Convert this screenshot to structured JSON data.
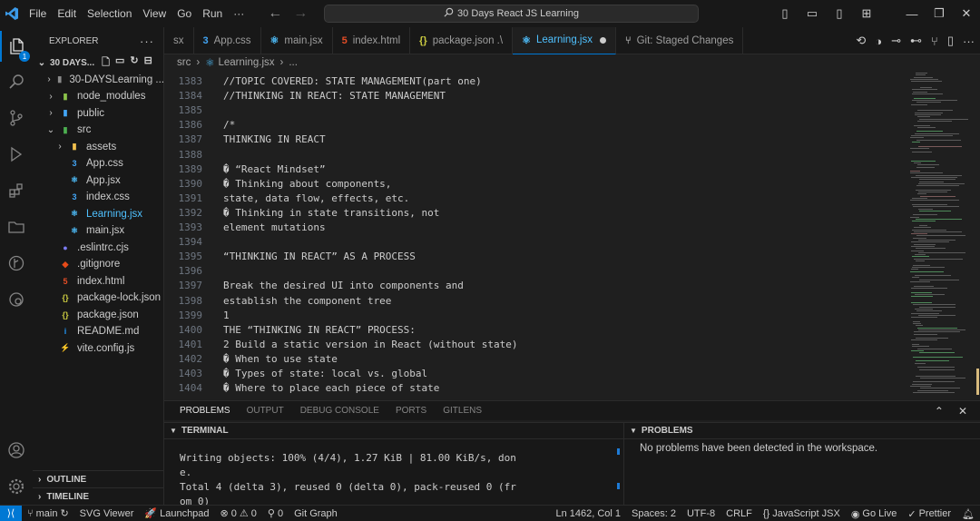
{
  "titlebar": {
    "menu": [
      "File",
      "Edit",
      "Selection",
      "View",
      "Go",
      "Run",
      "···"
    ],
    "search": "30 Days React JS Learning",
    "icons": [
      "vscode-logo-icon",
      "back-arrow-icon",
      "forward-arrow-icon",
      "search-icon",
      "toggle-sidebar-icon",
      "toggle-panel-icon",
      "toggle-secondary-sidebar-icon",
      "customize-layout-icon",
      "minimize-icon",
      "restore-icon",
      "close-icon"
    ]
  },
  "activitybar": {
    "badge": "1"
  },
  "explorer": {
    "title": "EXPLORER",
    "more": "···",
    "root": "30 DAYS...",
    "tree": [
      {
        "label": "30-DAYSLearning ...",
        "kind": "folder",
        "open": false,
        "depth": 1
      },
      {
        "label": "node_modules",
        "kind": "folder-green",
        "open": false,
        "depth": 1
      },
      {
        "label": "public",
        "kind": "folder-blue",
        "open": false,
        "depth": 1
      },
      {
        "label": "src",
        "kind": "folder-src",
        "open": true,
        "depth": 1
      },
      {
        "label": "assets",
        "kind": "folder-yellow",
        "open": false,
        "depth": 2
      },
      {
        "label": "App.css",
        "kind": "css",
        "depth": 2
      },
      {
        "label": "App.jsx",
        "kind": "react",
        "depth": 2
      },
      {
        "label": "index.css",
        "kind": "css",
        "depth": 2
      },
      {
        "label": "Learning.jsx",
        "kind": "react",
        "depth": 2,
        "selected": true
      },
      {
        "label": "main.jsx",
        "kind": "react",
        "depth": 2
      },
      {
        "label": ".eslintrc.cjs",
        "kind": "eslint",
        "depth": 1
      },
      {
        "label": ".gitignore",
        "kind": "git",
        "depth": 1
      },
      {
        "label": "index.html",
        "kind": "html",
        "depth": 1
      },
      {
        "label": "package-lock.json",
        "kind": "json",
        "depth": 1
      },
      {
        "label": "package.json",
        "kind": "json",
        "depth": 1
      },
      {
        "label": "README.md",
        "kind": "info",
        "depth": 1
      },
      {
        "label": "vite.config.js",
        "kind": "vite",
        "depth": 1
      }
    ],
    "outline": "OUTLINE",
    "timeline": "TIMELINE"
  },
  "tabs": [
    {
      "label": "sx",
      "icon": "",
      "active": false
    },
    {
      "label": "App.css",
      "icon": "css",
      "active": false
    },
    {
      "label": "main.jsx",
      "icon": "react",
      "active": false
    },
    {
      "label": "index.html",
      "icon": "html",
      "active": false
    },
    {
      "label": "package.json .\\",
      "icon": "json",
      "active": false
    },
    {
      "label": "Learning.jsx",
      "icon": "react",
      "active": true,
      "dirty": true
    },
    {
      "label": "Git: Staged Changes",
      "icon": "git",
      "active": false
    }
  ],
  "breadcrumb": [
    "src",
    "Learning.jsx",
    "..."
  ],
  "editor": {
    "lines": [
      {
        "n": "1383",
        "t": "//TOPIC COVERED: STATE MANAGEMENT(part one)"
      },
      {
        "n": "1384",
        "t": "//THINKING IN REACT: STATE MANAGEMENT"
      },
      {
        "n": "1385",
        "t": ""
      },
      {
        "n": "1386",
        "t": "/*"
      },
      {
        "n": "1387",
        "t": "THINKING IN REACT"
      },
      {
        "n": "1388",
        "t": ""
      },
      {
        "n": "1389",
        "t": "� “React Mindset”"
      },
      {
        "n": "1390",
        "t": "� Thinking about components,"
      },
      {
        "n": "1391",
        "t": "state, data flow, effects, etc."
      },
      {
        "n": "1392",
        "t": "� Thinking in state transitions, not"
      },
      {
        "n": "1393",
        "t": "element mutations"
      },
      {
        "n": "1394",
        "t": ""
      },
      {
        "n": "1395",
        "t": "“THINKING IN REACT” AS A PROCESS"
      },
      {
        "n": "1396",
        "t": ""
      },
      {
        "n": "1397",
        "t": "Break the desired UI into components and"
      },
      {
        "n": "1398",
        "t": "establish the component tree"
      },
      {
        "n": "1399",
        "t": "1"
      },
      {
        "n": "1400",
        "t": "THE “THINKING IN REACT” PROCESS:"
      },
      {
        "n": "1401",
        "t": "2 Build a static version in React (without state)"
      },
      {
        "n": "1402",
        "t": "� When to use state"
      },
      {
        "n": "1403",
        "t": "� Types of state: local vs. global"
      },
      {
        "n": "1404",
        "t": "� Where to place each piece of state"
      }
    ]
  },
  "panel": {
    "tabs": [
      "PROBLEMS",
      "OUTPUT",
      "DEBUG CONSOLE",
      "PORTS",
      "GITLENS"
    ],
    "terminal_title": "TERMINAL",
    "terminal_lines": [
      "Writing objects: 100% (4/4), 1.27 KiB | 81.00 KiB/s, don",
      "e.",
      "Total 4 (delta 3), reused 0 (delta 0), pack-reused 0 (fr",
      "om 0)"
    ],
    "problems_title": "PROBLEMS",
    "problems_message": "No problems have been detected in the workspace."
  },
  "statusbar": {
    "remote": "⟩⟨",
    "branch": "main",
    "sync": "↻",
    "svg_viewer": "SVG Viewer",
    "launchpad": "Launchpad",
    "errors": "0",
    "warnings": "0",
    "ports": "0",
    "git_graph": "Git Graph",
    "position": "Ln 1462, Col 1",
    "spaces": "Spaces: 2",
    "encoding": "UTF-8",
    "eol": "CRLF",
    "language": "JavaScript JSX",
    "golive": "Go Live",
    "prettier": "Prettier"
  },
  "colors": {
    "accent": "#0078d4",
    "active_file": "#4fc1ff",
    "background": "#1f1f1f",
    "chrome": "#181818"
  }
}
